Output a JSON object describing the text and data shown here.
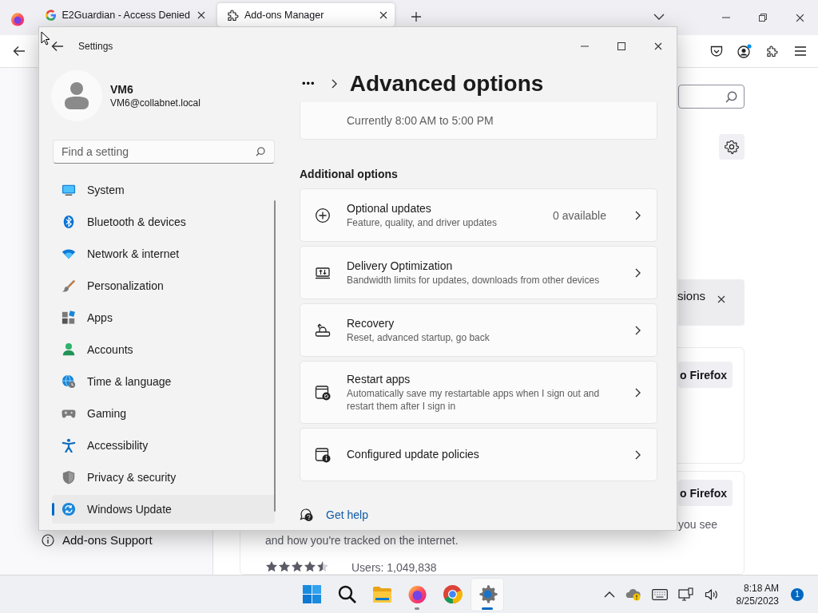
{
  "browser": {
    "tabs": [
      {
        "title": "E2Guardian - Access Denied",
        "kind": "google",
        "selected": false
      },
      {
        "title": "Add-ons Manager",
        "kind": "addons",
        "selected": true
      }
    ],
    "page": {
      "banner_text": "sions",
      "install_buttons": [
        "o Firefox",
        "o Firefox"
      ],
      "card_text": "you see",
      "sidebar_link": "Add-ons Support",
      "extension_summary": "and how you're tracked on the internet.",
      "stars": 4.5,
      "users": "Users: 1,049,838"
    }
  },
  "settings": {
    "title": "Settings",
    "user": {
      "name": "VM6",
      "email": "VM6@collabnet.local"
    },
    "search": {
      "placeholder": "Find a setting"
    },
    "nav": [
      {
        "label": "System",
        "kind": "system",
        "selected": false
      },
      {
        "label": "Bluetooth & devices",
        "kind": "bluetooth",
        "selected": false
      },
      {
        "label": "Network & internet",
        "kind": "network",
        "selected": false
      },
      {
        "label": "Personalization",
        "kind": "personalization",
        "selected": false
      },
      {
        "label": "Apps",
        "kind": "apps",
        "selected": false
      },
      {
        "label": "Accounts",
        "kind": "accounts",
        "selected": false
      },
      {
        "label": "Time & language",
        "kind": "time",
        "selected": false
      },
      {
        "label": "Gaming",
        "kind": "gaming",
        "selected": false
      },
      {
        "label": "Accessibility",
        "kind": "accessibility",
        "selected": false
      },
      {
        "label": "Privacy & security",
        "kind": "privacy",
        "selected": false
      },
      {
        "label": "Windows Update",
        "kind": "update",
        "selected": true
      }
    ],
    "breadcrumb": {
      "overflow": "•••",
      "title": "Advanced options"
    },
    "schedule_text": "Currently 8:00 AM to 5:00 PM",
    "section_title": "Additional options",
    "options": [
      {
        "kind": "optional",
        "title": "Optional updates",
        "description": "Feature, quality, and driver updates",
        "value": "0 available"
      },
      {
        "kind": "delivery",
        "title": "Delivery Optimization",
        "description": "Bandwidth limits for updates, downloads from other devices"
      },
      {
        "kind": "recovery",
        "title": "Recovery",
        "description": "Reset, advanced startup, go back"
      },
      {
        "kind": "restart",
        "title": "Restart apps",
        "description": "Automatically save my restartable apps when I sign out and restart them after I sign in"
      },
      {
        "kind": "policies",
        "title": "Configured update policies"
      }
    ],
    "help_link": "Get help"
  },
  "taskbar": {
    "apps": [
      {
        "kind": "start",
        "running": false,
        "selected": false
      },
      {
        "kind": "search",
        "running": false,
        "selected": false
      },
      {
        "kind": "explorer",
        "running": false,
        "selected": false
      },
      {
        "kind": "firefox",
        "running": true,
        "selected": false
      },
      {
        "kind": "chrome",
        "running": false,
        "selected": false
      },
      {
        "kind": "settings",
        "running": true,
        "selected": true
      }
    ],
    "clock": {
      "time": "8:18 AM",
      "date": "8/25/2023"
    },
    "notification_count": "1"
  }
}
